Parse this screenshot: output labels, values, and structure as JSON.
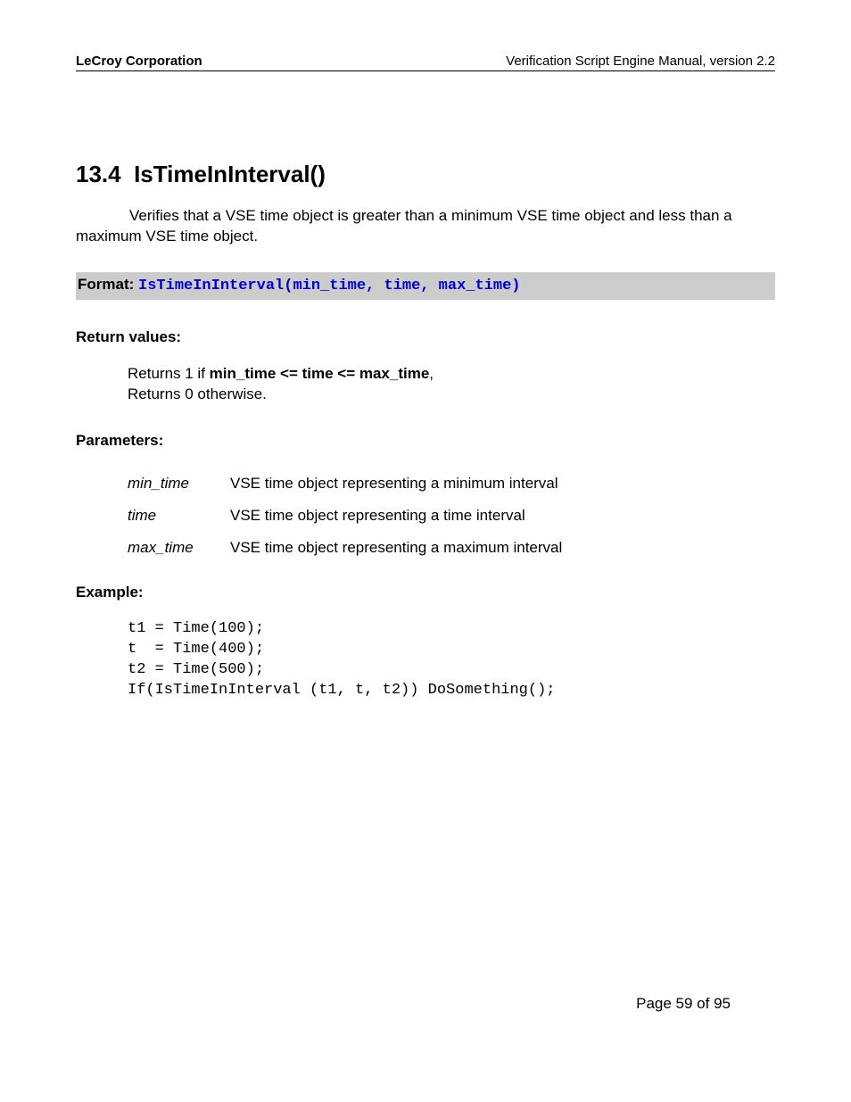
{
  "header": {
    "left": "LeCroy Corporation",
    "right": "Verification Script Engine Manual, version 2.2"
  },
  "section": {
    "number": "13.4",
    "title": "IsTimeInInterval()"
  },
  "intro": "Verifies that a VSE time object is greater than a minimum VSE time object and less than a maximum VSE time object.",
  "format": {
    "label": "Format:",
    "code": "IsTimeInInterval(min_time, time, max_time)"
  },
  "return_values": {
    "heading": "Return values:",
    "line1_prefix": "Returns 1 if ",
    "line1_bold": "min_time <= time <= max_time",
    "line1_suffix": ",",
    "line2": "Returns 0 otherwise."
  },
  "parameters": {
    "heading": "Parameters:",
    "rows": [
      {
        "name": "min_time",
        "desc": "VSE time object representing a minimum interval"
      },
      {
        "name": "time",
        "desc": "VSE time object representing a time interval"
      },
      {
        "name": "max_time",
        "desc": "VSE time object representing a maximum interval"
      }
    ]
  },
  "example": {
    "heading": "Example:",
    "code": "t1 = Time(100);\nt  = Time(400);\nt2 = Time(500);\nIf(IsTimeInInterval (t1, t, t2)) DoSomething();"
  },
  "footer": "Page 59 of 95"
}
